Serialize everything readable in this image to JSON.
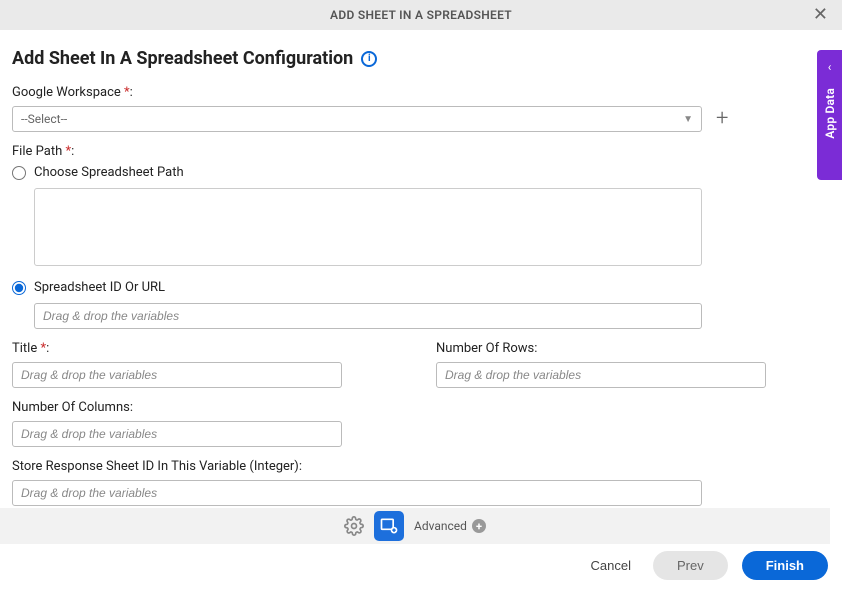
{
  "header": {
    "title": "ADD SHEET IN A SPREADSHEET"
  },
  "page": {
    "title": "Add Sheet In A Spreadsheet Configuration"
  },
  "fields": {
    "workspace": {
      "label": "Google Workspace ",
      "selected": "--Select--"
    },
    "filepath": {
      "label": "File Path ",
      "option1": "Choose Spreadsheet Path",
      "option2": "Spreadsheet ID Or URL",
      "placeholder2": "Drag & drop the variables"
    },
    "title": {
      "label": "Title ",
      "placeholder": "Drag & drop the variables"
    },
    "numRows": {
      "label": "Number Of Rows:",
      "placeholder": "Drag & drop the variables"
    },
    "numCols": {
      "label": "Number Of Columns:",
      "placeholder": "Drag & drop the variables"
    },
    "storeVar": {
      "label": "Store Response Sheet ID In This Variable (Integer):",
      "placeholder": "Drag & drop the variables"
    }
  },
  "toolbar": {
    "advanced": "Advanced"
  },
  "buttons": {
    "cancel": "Cancel",
    "prev": "Prev",
    "finish": "Finish"
  },
  "sidetab": {
    "label": "App Data"
  },
  "required_marker": "*",
  "colon": ":"
}
